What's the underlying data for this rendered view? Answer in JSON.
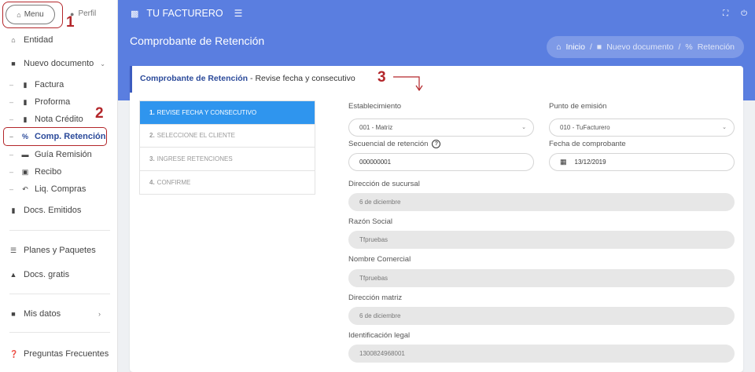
{
  "sidebar": {
    "menu_label": "Menu",
    "perfil_label": "Perfil",
    "items": {
      "entidad": "Entidad",
      "nuevo_documento": "Nuevo documento",
      "factura": "Factura",
      "proforma": "Proforma",
      "nota_credito": "Nota Crédito",
      "comp_retencion": "Comp. Retención",
      "guia_remision": "Guía Remisión",
      "recibo": "Recibo",
      "liq_compras": "Liq. Compras",
      "docs_emitidos": "Docs. Emitidos",
      "planes": "Planes y Paquetes",
      "docs_gratis": "Docs. gratis",
      "mis_datos": "Mis datos",
      "preguntas": "Preguntas Frecuentes"
    }
  },
  "annotations": {
    "a1": "1",
    "a2": "2",
    "a3": "3"
  },
  "topbar": {
    "brand": "TU FACTURERO"
  },
  "header": {
    "title": "Comprobante de Retención",
    "breadcrumb": {
      "home": "Inicio",
      "sep": "/",
      "nuevo": "Nuevo documento",
      "current": "Retención"
    }
  },
  "card": {
    "title": "Comprobante de Retención",
    "subtitle": "Revise fecha y consecutivo",
    "steps": [
      {
        "num": "1.",
        "label": "REVISE FECHA Y CONSECUTIVO"
      },
      {
        "num": "2.",
        "label": "SELECCIONE EL CLIENTE"
      },
      {
        "num": "3.",
        "label": "INGRESE RETENCIONES"
      },
      {
        "num": "4.",
        "label": "CONFIRME"
      }
    ]
  },
  "form": {
    "establecimiento_label": "Establecimiento",
    "establecimiento_value": "001 - Matriz",
    "punto_label": "Punto de emisión",
    "punto_value": "010 - TuFacturero",
    "secuencial_label": "Secuencial de retención",
    "secuencial_value": "000000001",
    "fecha_label": "Fecha de comprobante",
    "fecha_value": "13/12/2019",
    "direccion_sucursal_label": "Dirección de sucursal",
    "direccion_sucursal_value": "6 de diciembre",
    "razon_label": "Razón Social",
    "razon_value": "Tfpruebas",
    "nombre_label": "Nombre Comercial",
    "nombre_value": "Tfpruebas",
    "direccion_matriz_label": "Dirección matriz",
    "direccion_matriz_value": "6 de diciembre",
    "identificacion_label": "Identificación legal",
    "identificacion_value": "1300824968001"
  }
}
